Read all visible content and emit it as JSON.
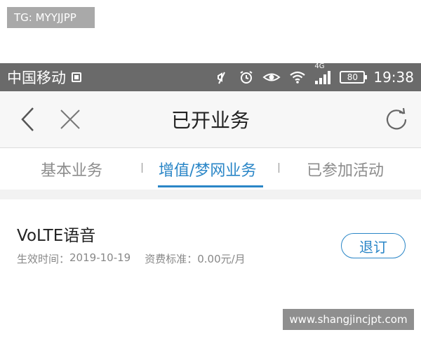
{
  "overlay": {
    "tg_label": "TG: MYYJJPP",
    "watermark": "www.shangjincjpt.com"
  },
  "status_bar": {
    "carrier": "中国移动",
    "network": "4G",
    "battery": "80",
    "time": "19:38",
    "icons": [
      "sim-icon",
      "mute-icon",
      "alarm-icon",
      "eye-icon",
      "wifi-icon",
      "signal-icon",
      "battery-icon"
    ]
  },
  "nav": {
    "title": "已开业务",
    "icons": [
      "back-icon",
      "close-icon",
      "refresh-icon"
    ]
  },
  "tabs": [
    {
      "label": "基本业务",
      "active": false
    },
    {
      "label": "增值/梦网业务",
      "active": true
    },
    {
      "label": "已参加活动",
      "active": false
    }
  ],
  "services": [
    {
      "name": "VoLTE语音",
      "effective_label": "生效时间：",
      "effective_date": "2019-10-19",
      "fee_label": "资费标准：",
      "fee_value": "0.00元/月",
      "action_label": "退订"
    }
  ],
  "colors": {
    "accent": "#2a86c7",
    "status_bar": "#6a6a6a",
    "nav_bg": "#f7f7f7",
    "inactive_tab": "#8c8c8c"
  }
}
